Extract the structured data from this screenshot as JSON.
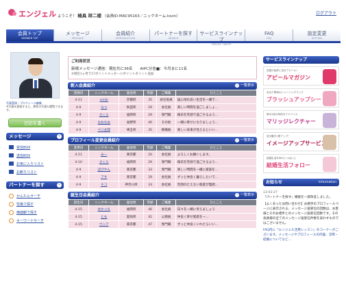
{
  "header": {
    "logo_text": "エンジェル",
    "welcome": "ようこそ！",
    "user_name": "椿具 祥二様",
    "member_info": "（会員ID:MAC95163／ニックネーム:lovin）",
    "logout": "ログアウト"
  },
  "nav": [
    {
      "jp": "会員トップ",
      "en": "MEMBER TOP",
      "active": true
    },
    {
      "jp": "メッセージ",
      "en": "MESSAGE"
    },
    {
      "jp": "会員紹介",
      "en": "INTRODUCTION"
    },
    {
      "jp": "パートナーを探す",
      "en": "SEARCH"
    },
    {
      "jp": "サービスラインナップ",
      "en": "SERVICE LINEUP"
    },
    {
      "jp": "FAQ",
      "en": "FAQ"
    },
    {
      "jp": "設定変更",
      "en": "SETTING"
    }
  ],
  "left": {
    "photo_caption": "写真登録・プロフィール編集",
    "photo_note": "※写真を登録すると、異性の写真も閲覧できます。",
    "diary_button": "日記を書く",
    "message_title": "メッセージ",
    "message_items": [
      "受信BOX",
      "送信BOX",
      "お気に入りリスト",
      "お断りリスト"
    ],
    "search_title": "パートナーを探す",
    "search_items": [
      "かんたんサーチ",
      "性格で探す",
      "価値観で探す",
      "キーワードサーチ"
    ]
  },
  "status": {
    "title": "ご利用状況",
    "line1": "新規メッセージ通信：現在共に36名　　AIPC分告■：今月まに11名",
    "line2": "※現在1ヶ月で17ポイントメッセージポイントボイント追加"
  },
  "sections": [
    {
      "title": "新入会員紹介",
      "more": "一覧表示",
      "headers": [
        "登録日",
        "ニックネーム",
        "居住地",
        "年齢",
        "ご職業",
        "ひとこと"
      ],
      "rows": [
        [
          "4-11",
          "smile",
          "京都府",
          "35",
          "会社役員",
          "居心地の良い生活を一緒で…"
        ],
        [
          "4-9",
          "なつ",
          "秋田県",
          "29",
          "会社員",
          "楽しい時間を過ごしましょ…"
        ],
        [
          "4-9",
          "さくら",
          "福岡県",
          "29",
          "専門職",
          "毎日を笑顔で過ごせるよう…"
        ],
        [
          "4-9",
          "なおなお",
          "長野県",
          "40",
          "その他",
          "一緒に幸せになりましょう…"
        ],
        [
          "4-9",
          "ペリ太郎",
          "埼玉県",
          "35",
          "教職員",
          "楽しい未来が見えるといい…"
        ]
      ]
    },
    {
      "title": "プロフィール変更会員紹介",
      "more": "一覧表示",
      "headers": [
        "変更日",
        "ニックネーム",
        "居住地",
        "年齢",
        "ご職業",
        "ひとこと"
      ],
      "rows": [
        [
          "4-11",
          "みー",
          "東京都",
          "20",
          "会社員",
          "よろしくお願いします。"
        ],
        [
          "4-10",
          "さくら",
          "福岡県",
          "29",
          "専門職",
          "毎日を笑顔で過ごせるよう…"
        ],
        [
          "4-9",
          "ぱぴやん",
          "東京都",
          "33",
          "専門職",
          "楽しい時間を一緒に家族を…"
        ],
        [
          "4-9",
          "アサ",
          "東京都",
          "29",
          "会社員",
          "ずっと仲良く暮らしたいで…"
        ],
        [
          "4-9",
          "チコ",
          "神奈川県",
          "33",
          "会社員",
          "笑顔のたえない家庭が理想…"
        ]
      ]
    },
    {
      "title": "誕生日会員紹介",
      "more": "一覧表示",
      "headers": [
        "誕生日",
        "ニックネーム",
        "居住地",
        "年齢",
        "ご職業",
        "ひとこと"
      ],
      "rows": [
        [
          "4-15",
          "ゆかっち",
          "福岡県",
          "46",
          "会社員",
          "日々を一緒に考えましょう"
        ],
        [
          "4-15",
          "とも",
          "愛知県",
          "41",
          "公務員",
          "仲良く幸せ家庭を一…"
        ],
        [
          "4-15",
          "ウンア",
          "東京都",
          "47",
          "専門職",
          "ずっと仲良くいれたらいい…"
        ]
      ]
    }
  ],
  "right": {
    "lineup_title": "サービスラインナップ",
    "lineup_en": "",
    "banners": [
      {
        "small": "恋愛の免許に自分アピール！",
        "big": "アピールマガジン",
        "color": "#d83060",
        "img": "#e03a6a"
      },
      {
        "small": "あなた専用のトレーニングブック",
        "big": "ブラッシュアップシート",
        "color": "#e5548a",
        "img": "#f0a8c0"
      },
      {
        "small": "毎月1回の特別なアドバイス",
        "big": "マリッジレクチャー",
        "color": "#c03a8a",
        "img": "#c7b4d8"
      },
      {
        "small": "自分磨き1冊アップ！",
        "big": "イメージアップサービス",
        "color": "#b02050",
        "img": "#d9c0a8"
      },
      {
        "small": "結婚生活を幸せいっぱいに",
        "big": "結婚生活フォロー",
        "color": "#e0457b",
        "img": "#f5c8d8"
      }
    ],
    "info_title": "お知らせ",
    "info_en": "Information",
    "news1_date": "13-03-27",
    "news1": "「パートナーを探す」機能を一部改変しました。",
    "news2": "【よくあったお問い合わせ】お相手のプロフィールページに表示される、メッセージ送受信の回数は、お客様とそのお相手とのメッセージ送受信回数です。その会員様の全てのメッセージ送受信件数を表わすものではございません。",
    "news3": "FAQ内に「エンジェル活用レッスン」のコーナーがございます。メッセージやプロフィールの内容、交際・結婚についてなど…"
  }
}
